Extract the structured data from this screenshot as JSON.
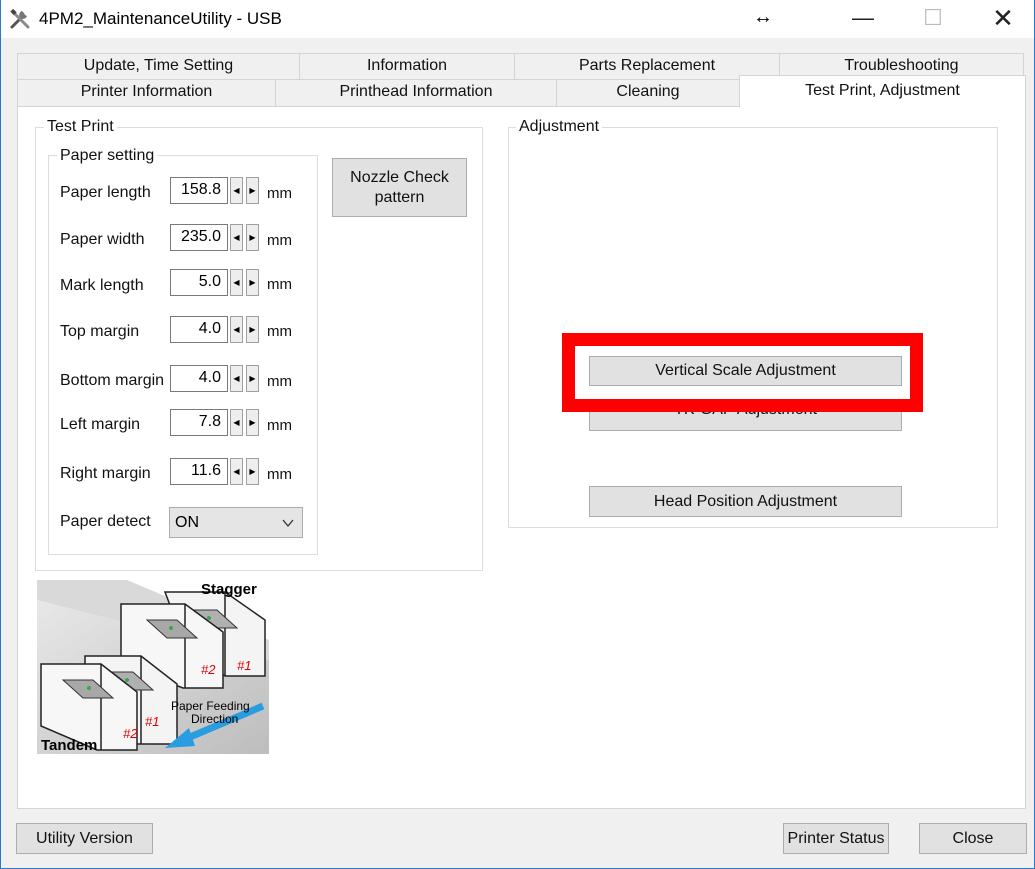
{
  "window": {
    "title": "4PM2_MaintenanceUtility - USB",
    "resize_glyph": "↔",
    "min_glyph": "—",
    "max_glyph": "☐",
    "close_glyph": "✕"
  },
  "tabs_row1": [
    {
      "label": "Update, Time Setting"
    },
    {
      "label": "Information"
    },
    {
      "label": "Parts Replacement"
    },
    {
      "label": "Troubleshooting"
    }
  ],
  "tabs_row2": [
    {
      "label": "Printer Information"
    },
    {
      "label": "Printhead Information"
    },
    {
      "label": "Cleaning"
    },
    {
      "label": "Test Print, Adjustment",
      "selected": true
    }
  ],
  "test_print": {
    "legend": "Test Print",
    "paper_setting_legend": "Paper setting",
    "unit": "mm",
    "fields": [
      {
        "label": "Paper length",
        "value": "158.8"
      },
      {
        "label": "Paper width",
        "value": "235.0"
      },
      {
        "label": "Mark length",
        "value": "5.0"
      },
      {
        "label": "Top margin",
        "value": "4.0"
      },
      {
        "label": "Bottom margin",
        "value": "4.0"
      },
      {
        "label": "Left margin",
        "value": "7.8"
      },
      {
        "label": "Right margin",
        "value": "11.6"
      }
    ],
    "paper_detect": {
      "label": "Paper detect",
      "value": "ON"
    },
    "nozzle_button": {
      "line1": "Nozzle Check",
      "line2": "pattern"
    },
    "spin_left": "◀",
    "spin_right": "▶"
  },
  "illustration": {
    "stagger": "Stagger",
    "tandem": "Tandem",
    "feed_line1": "Paper Feeding",
    "feed_line2": "Direction",
    "mark1": "#1",
    "mark2": "#2"
  },
  "adjustment": {
    "legend": "Adjustment",
    "vertical_scale": "Vertical Scale Adjustment",
    "tk_gap": "TK-GAP Adjustment",
    "head_position": "Head Position Adjustment"
  },
  "footer": {
    "utility_version": "Utility Version",
    "printer_status": "Printer Status",
    "close": "Close"
  },
  "colors": {
    "highlight": "#ff0000",
    "window_border": "#2b79c9",
    "arrow": "#2a9de0"
  }
}
